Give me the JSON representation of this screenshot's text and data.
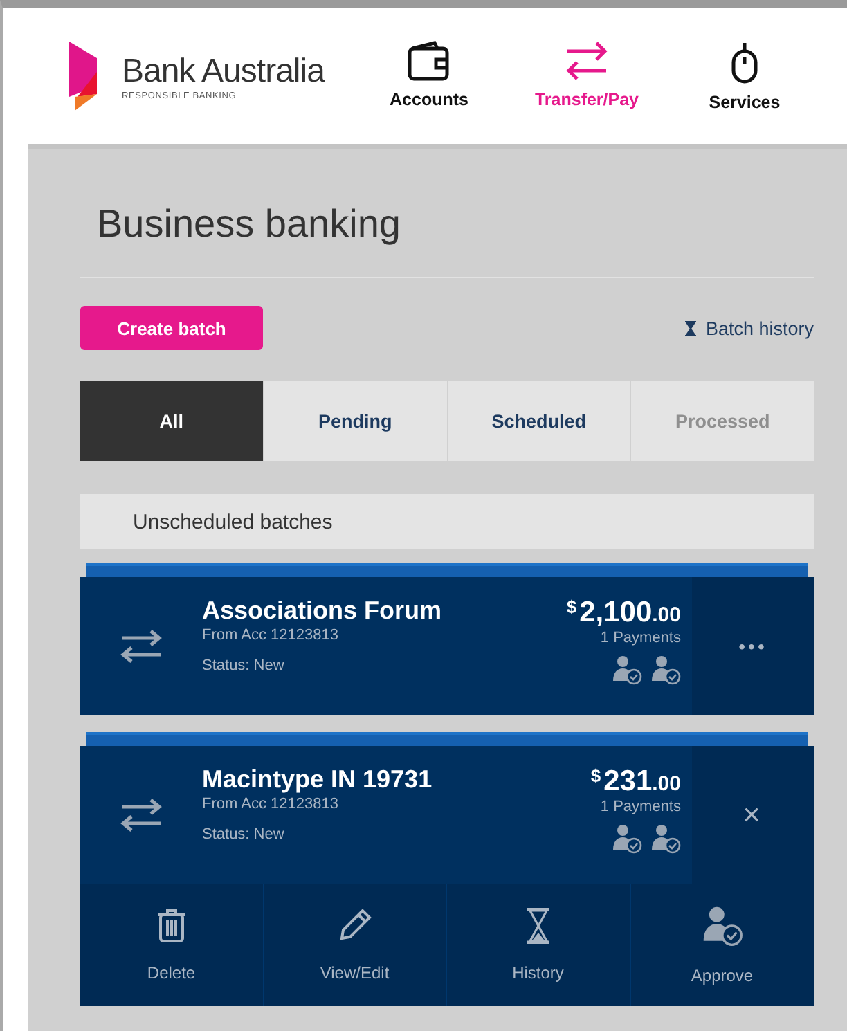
{
  "brand": {
    "name": "Bank Australia",
    "tagline": "RESPONSIBLE BANKING"
  },
  "nav": [
    {
      "label": "Accounts",
      "kind": "wallet",
      "selected": false
    },
    {
      "label": "Transfer/Pay",
      "kind": "transfer",
      "selected": true
    },
    {
      "label": "Services",
      "kind": "mouse",
      "selected": false
    }
  ],
  "page_title": "Business banking",
  "create_button": "Create batch",
  "history_link": "Batch history",
  "tabs": [
    {
      "label": "All",
      "selected": true,
      "disabled": false
    },
    {
      "label": "Pending",
      "selected": false,
      "disabled": false
    },
    {
      "label": "Scheduled",
      "selected": false,
      "disabled": false
    },
    {
      "label": "Processed",
      "selected": false,
      "disabled": true
    }
  ],
  "section_heading": "Unscheduled batches",
  "batches": [
    {
      "name": "Associations Forum",
      "account": "From Acc 12123813",
      "status": "Status: New",
      "currency": "$",
      "amount": "2,100",
      "cents": ".00",
      "payments": "1 Payments",
      "expanded": false,
      "menu": "•••"
    },
    {
      "name": "Macintype IN 19731",
      "account": "From Acc 12123813",
      "status": "Status: New",
      "currency": "$",
      "amount": "231",
      "cents": ".00",
      "payments": "1 Payments",
      "expanded": true,
      "menu": "×"
    }
  ],
  "actions": [
    {
      "label": "Delete",
      "kind": "delete"
    },
    {
      "label": "View/Edit",
      "kind": "edit"
    },
    {
      "label": "History",
      "kind": "history"
    },
    {
      "label": "Approve",
      "kind": "approve"
    }
  ]
}
